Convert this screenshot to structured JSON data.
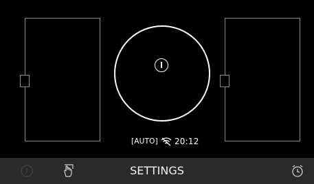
{
  "screen": {
    "status": {
      "mode": "[AUTO]",
      "time": "20:12"
    },
    "bottom_bar": {
      "title": "SETTINGS"
    },
    "icons": {
      "center": "power-icon",
      "bar_left": "power-dim-icon",
      "bar_hand": "hand-touch-icon",
      "bar_right": "alarm-clock-icon",
      "status": "wifi-icon"
    }
  }
}
